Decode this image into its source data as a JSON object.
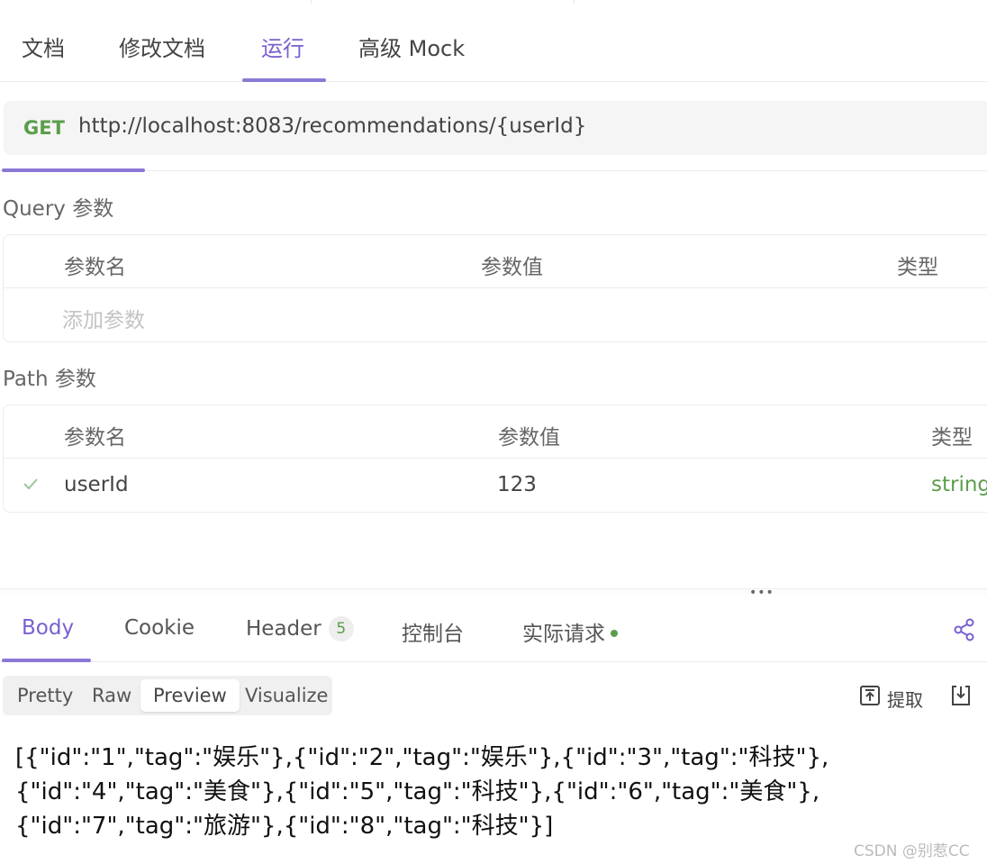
{
  "top_tabs": [
    {
      "label": "文档"
    },
    {
      "label": "修改文档"
    },
    {
      "label": "运行",
      "active": true
    },
    {
      "label": "高级 Mock"
    }
  ],
  "request": {
    "method": "GET",
    "url": "http://localhost:8083/recommendations/{userId}"
  },
  "query_params": {
    "title": "Query 参数",
    "headers": [
      "参数名",
      "参数值",
      "类型"
    ],
    "placeholder": "添加参数"
  },
  "path_params": {
    "title": "Path 参数",
    "headers": [
      "参数名",
      "参数值",
      "类型"
    ],
    "rows": [
      {
        "name": "userId",
        "value": "123",
        "type": "string",
        "checked": true
      }
    ]
  },
  "response_tabs": [
    {
      "label": "Body",
      "active": true
    },
    {
      "label": "Cookie"
    },
    {
      "label": "Header",
      "badge": "5"
    },
    {
      "label": "控制台"
    },
    {
      "label": "实际请求",
      "dot": true
    }
  ],
  "share_icon": "share-icon",
  "view_modes": [
    {
      "label": "Pretty"
    },
    {
      "label": "Raw"
    },
    {
      "label": "Preview",
      "active": true
    },
    {
      "label": "Visualize"
    }
  ],
  "toolbar": {
    "extract_label": "提取",
    "extract_icon": "extract-icon",
    "download_icon": "download-icon"
  },
  "body_lines": [
    "[{\"id\":\"1\",\"tag\":\"娱乐\"},{\"id\":\"2\",\"tag\":\"娱乐\"},{\"id\":\"3\",\"tag\":\"科技\"},",
    "{\"id\":\"4\",\"tag\":\"美食\"},{\"id\":\"5\",\"tag\":\"科技\"},{\"id\":\"6\",\"tag\":\"美食\"},",
    "{\"id\":\"7\",\"tag\":\"旅游\"},{\"id\":\"8\",\"tag\":\"科技\"}]"
  ],
  "watermark": "CSDN @别惹CC",
  "colors": {
    "accent": "#8c78d6",
    "method_get": "#5a9e4a",
    "type_string": "#5a9e4a"
  }
}
